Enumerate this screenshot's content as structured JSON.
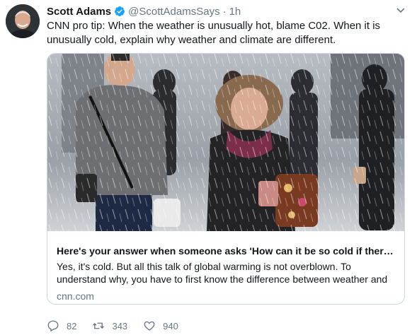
{
  "tweet": {
    "display_name": "Scott Adams",
    "verified_icon": "verified-badge-icon",
    "handle": "@ScottAdamsSays",
    "separator": "·",
    "time": "1h",
    "text": "CNN pro tip: When the weather is unusually hot, blame C02. When it is unusually cold, explain why weather and climate are different."
  },
  "card": {
    "image_icon": "snowy-street-photo",
    "title": "Here's your answer when someone asks 'How can it be so cold if ther…",
    "description": "Yes, it's cold. But all this talk of global warming is not overblown. To understand why, you have to first know the difference between weather and",
    "domain": "cnn.com"
  },
  "actions": {
    "reply_count": "82",
    "retweet_count": "343",
    "like_count": "940"
  },
  "colors": {
    "verified": "#1da1f2",
    "muted": "#657786",
    "border": "#ccd6dd"
  }
}
